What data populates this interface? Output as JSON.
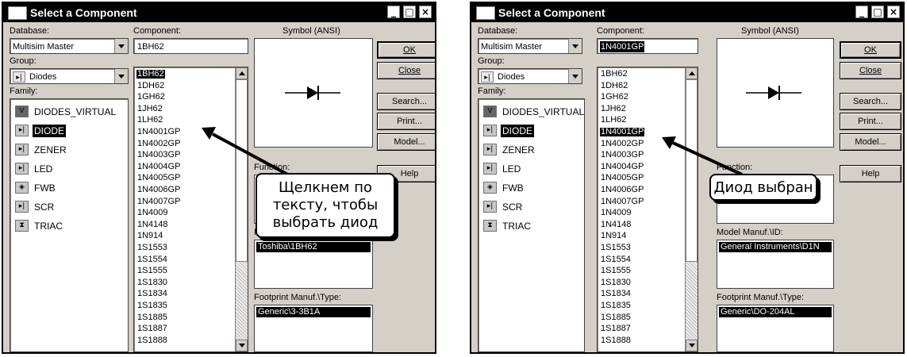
{
  "left": {
    "title": "Select a Component",
    "caption_buttons": {
      "minimize": "_",
      "maximize": "□",
      "close": "×"
    },
    "database_label": "Database:",
    "database_value": "Multisim Master",
    "group_label": "Group:",
    "group_value": "Diodes",
    "group_icon": "diode-group-icon",
    "family_label": "Family:",
    "families": [
      {
        "label": "DIODES_VIRTUAL",
        "icon": "virtual-diode-icon",
        "glyph": "V"
      },
      {
        "label": "DIODE",
        "icon": "diode-icon",
        "glyph": "▸|"
      },
      {
        "label": "ZENER",
        "icon": "zener-icon",
        "glyph": "▸|"
      },
      {
        "label": "LED",
        "icon": "led-icon",
        "glyph": "▸|"
      },
      {
        "label": "FWB",
        "icon": "bridge-icon",
        "glyph": "◈"
      },
      {
        "label": "SCR",
        "icon": "scr-icon",
        "glyph": "▸|"
      },
      {
        "label": "TRIAC",
        "icon": "triac-icon",
        "glyph": "⧗"
      }
    ],
    "selected_family": "DIODE",
    "component_label": "Component:",
    "component_value": "1BH62",
    "components": [
      "1BH62",
      "1DH62",
      "1GH62",
      "1JH62",
      "1LH62",
      "1N4001GP",
      "1N4002GP",
      "1N4003GP",
      "1N4004GP",
      "1N4005GP",
      "1N4006GP",
      "1N4007GP",
      "1N4009",
      "1N4148",
      "1N914",
      "1S1553",
      "1S1554",
      "1S1555",
      "1S1830",
      "1S1834",
      "1S1835",
      "1S1885",
      "1S1887",
      "1S1888"
    ],
    "selected_component": "1BH62",
    "symbol_label": "Symbol (ANSI)",
    "buttons": {
      "ok": "OK",
      "close": "Close",
      "search": "Search...",
      "print": "Print...",
      "model": "Model...",
      "help": "Help"
    },
    "function_label": "Function:",
    "model_manuf_label": "M",
    "model_manuf_value": "Toshiba\\1BH62",
    "footprint_label": "Footprint Manuf.\\Type:",
    "footprint_value": "Generic\\3-3B1A",
    "callout_lines": [
      "Щелкнем по",
      "тексту, чтобы",
      "выбрать диод"
    ]
  },
  "right": {
    "title": "Select a Component",
    "caption_buttons": {
      "minimize": "_",
      "maximize": "□",
      "close": "×"
    },
    "database_label": "Database:",
    "database_value": "Multisim Master",
    "group_label": "Group:",
    "group_value": "Diodes",
    "group_icon": "diode-group-icon",
    "family_label": "Family:",
    "families": [
      {
        "label": "DIODES_VIRTUAL",
        "icon": "virtual-diode-icon",
        "glyph": "V"
      },
      {
        "label": "DIODE",
        "icon": "diode-icon",
        "glyph": "▸|"
      },
      {
        "label": "ZENER",
        "icon": "zener-icon",
        "glyph": "▸|"
      },
      {
        "label": "LED",
        "icon": "led-icon",
        "glyph": "▸|"
      },
      {
        "label": "FWB",
        "icon": "bridge-icon",
        "glyph": "◈"
      },
      {
        "label": "SCR",
        "icon": "scr-icon",
        "glyph": "▸|"
      },
      {
        "label": "TRIAC",
        "icon": "triac-icon",
        "glyph": "⧗"
      }
    ],
    "selected_family": "DIODE",
    "component_label": "Component:",
    "component_value": "1N4001GP",
    "components": [
      "1BH62",
      "1DH62",
      "1GH62",
      "1JH62",
      "1LH62",
      "1N4001GP",
      "1N4002GP",
      "1N4003GP",
      "1N4004GP",
      "1N4005GP",
      "1N4006GP",
      "1N4007GP",
      "1N4009",
      "1N4148",
      "1N914",
      "1S1553",
      "1S1554",
      "1S1555",
      "1S1830",
      "1S1834",
      "1S1835",
      "1S1885",
      "1S1887",
      "1S1888"
    ],
    "selected_component": "1N4001GP",
    "symbol_label": "Symbol (ANSI)",
    "buttons": {
      "ok": "OK",
      "close": "Close",
      "search": "Search...",
      "print": "Print...",
      "model": "Model...",
      "help": "Help"
    },
    "function_label": "Function:",
    "model_manuf_label": "Model Manuf.\\ID:",
    "model_manuf_value": "General Instruments\\D1N",
    "footprint_label": "Footprint Manuf.\\Type:",
    "footprint_value": "Generic\\DO-204AL",
    "callout_lines": [
      "Диод выбран"
    ]
  }
}
